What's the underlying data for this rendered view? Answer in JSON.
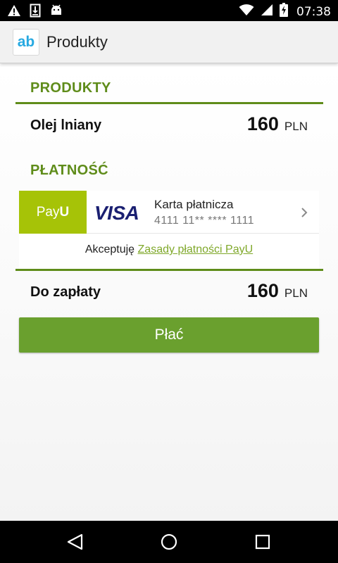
{
  "status_bar": {
    "time": "07:38",
    "left_icons": [
      "warning-icon",
      "download-icon",
      "android-icon"
    ],
    "right_icons": [
      "wifi-icon",
      "signal-icon",
      "battery-charging-icon"
    ]
  },
  "app_bar": {
    "logo_text": "ab",
    "title": "Produkty"
  },
  "products_section": {
    "header": "PRODUKTY",
    "items": [
      {
        "name": "Olej lniany",
        "price": "160",
        "currency": "PLN"
      }
    ]
  },
  "payment_section": {
    "header": "PŁATNOŚĆ",
    "provider_logo_main": "Pay",
    "provider_logo_accent": "U",
    "card_brand": "VISA",
    "card_title": "Karta płatnicza",
    "card_number": "4111 11** **** 1111",
    "accept_prefix": "Akceptuję ",
    "accept_link": "Zasady płatności PayU"
  },
  "total": {
    "label": "Do zapłaty",
    "amount": "160",
    "currency": "PLN"
  },
  "pay_button_label": "Płać",
  "colors": {
    "accent_green": "#5f8c1a",
    "button_green": "#6aa02e",
    "payu_green": "#a6c307",
    "visa_blue": "#1a1f71",
    "link_green": "#7fa82a",
    "logo_blue": "#27a9e1"
  },
  "nav_bar": {
    "icons": [
      "back-icon",
      "home-icon",
      "recents-icon"
    ]
  }
}
